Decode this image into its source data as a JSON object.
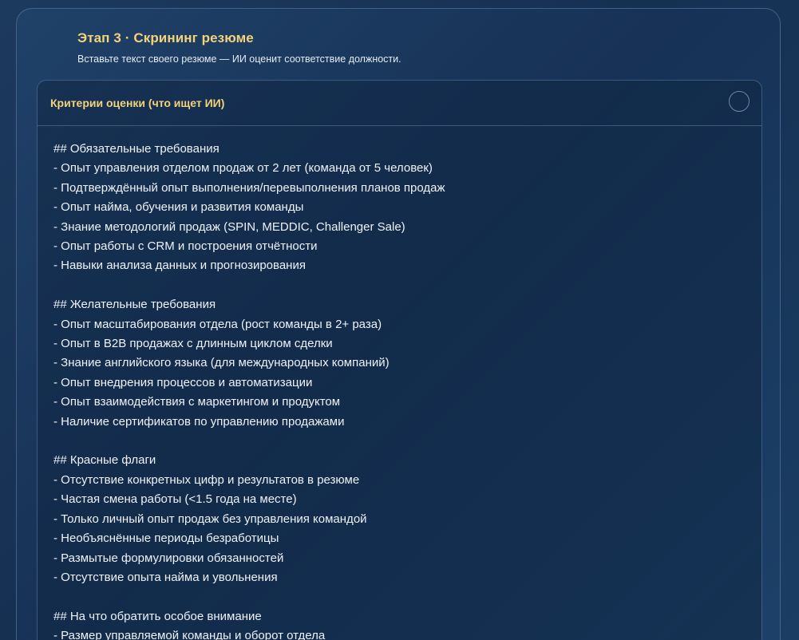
{
  "step": {
    "title": "Этап 3 · Скрининг резюме",
    "subtitle": "Вставьте текст своего резюме — ИИ оценит соответствие должности."
  },
  "criteria": {
    "title": "Критерии оценки (что ищет ИИ)",
    "lines": [
      "## Обязательные требования",
      "- Опыт управления отделом продаж от 2 лет (команда от 5 человек)",
      "- Подтверждённый опыт выполнения/перевыполнения планов продаж",
      "- Опыт найма, обучения и развития команды",
      "- Знание методологий продаж (SPIN, MEDDIC, Challenger Sale)",
      "- Опыт работы с CRM и построения отчётности",
      "- Навыки анализа данных и прогнозирования",
      "",
      "## Желательные требования",
      "- Опыт масштабирования отдела (рост команды в 2+ раза)",
      "- Опыт в B2B продажах с длинным циклом сделки",
      "- Знание английского языка (для международных компаний)",
      "- Опыт внедрения процессов и автоматизации",
      "- Опыт взаимодействия с маркетингом и продуктом",
      "- Наличие сертификатов по управлению продажами",
      "",
      "## Красные флаги",
      "- Отсутствие конкретных цифр и результатов в резюме",
      "- Частая смена работы (<1.5 года на месте)",
      "- Только личный опыт продаж без управления командой",
      "- Необъяснённые периоды безработицы",
      "- Размытые формулировки обязанностей",
      "- Отсутствие опыта найма и увольнения",
      "",
      "## На что обратить особое внимание",
      "- Размер управляемой команды и оборот отдела"
    ]
  }
}
